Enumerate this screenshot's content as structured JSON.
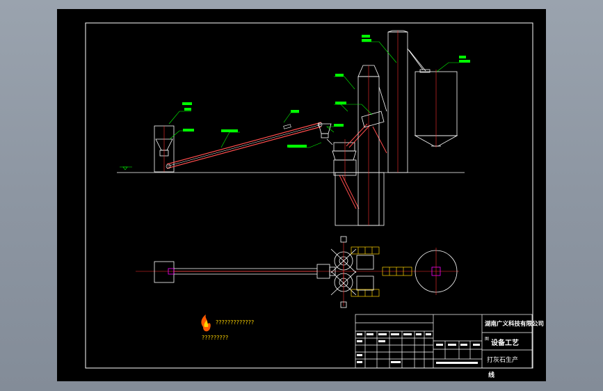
{
  "logo": {
    "title_text": "?????????????",
    "subtitle_text": "?????????"
  },
  "title_block": {
    "company": "湖南广义科技有限公司",
    "drawing_name_1": "设备工艺",
    "drawing_name_2": "图",
    "drawing_name_3": "打灰石生产",
    "drawing_name_4": "线",
    "small_char": "图"
  },
  "colors": {
    "background": "#000000",
    "frame": "#ffffff",
    "equipment": "#ffffff",
    "conveyor": "#ff4d4d",
    "centerline": "#ff3030",
    "leader": "#00ff00",
    "yellow": "#ffd400",
    "magenta": "#ff00ff"
  }
}
